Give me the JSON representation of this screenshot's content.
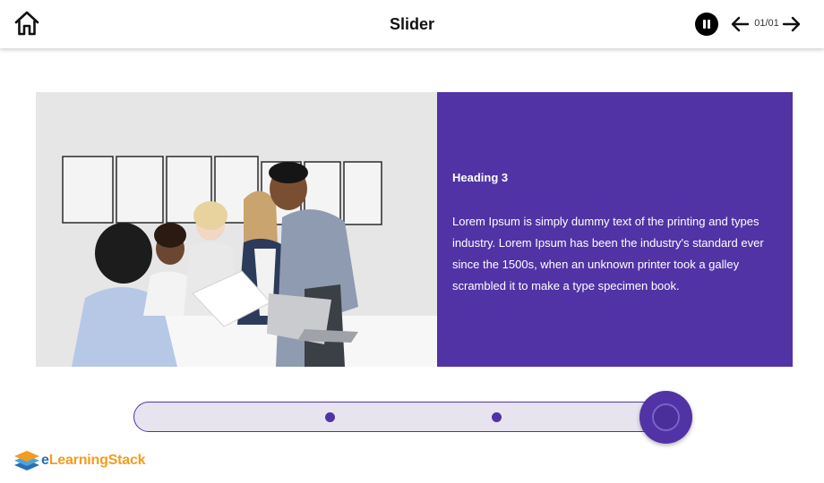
{
  "header": {
    "title": "Slider",
    "page_counter": "01/01",
    "icons": {
      "home": "home-icon",
      "pause": "pause-icon",
      "prev": "arrow-left-icon",
      "next": "arrow-right-icon"
    }
  },
  "slide": {
    "heading": "Heading 3",
    "body": "Lorem Ipsum is simply dummy text of the printing and types industry. Lorem Ipsum has been the industry's standard ever since the 1500s, when an unknown printer took a galley scrambled it to make a type specimen book.",
    "panel_color": "#5133a6"
  },
  "slider": {
    "dot_count": 2,
    "accent": "#5133a6",
    "track_color": "#e8e4ef"
  },
  "brand": {
    "logo_e": "e",
    "logo_rest": "LearningStack"
  }
}
